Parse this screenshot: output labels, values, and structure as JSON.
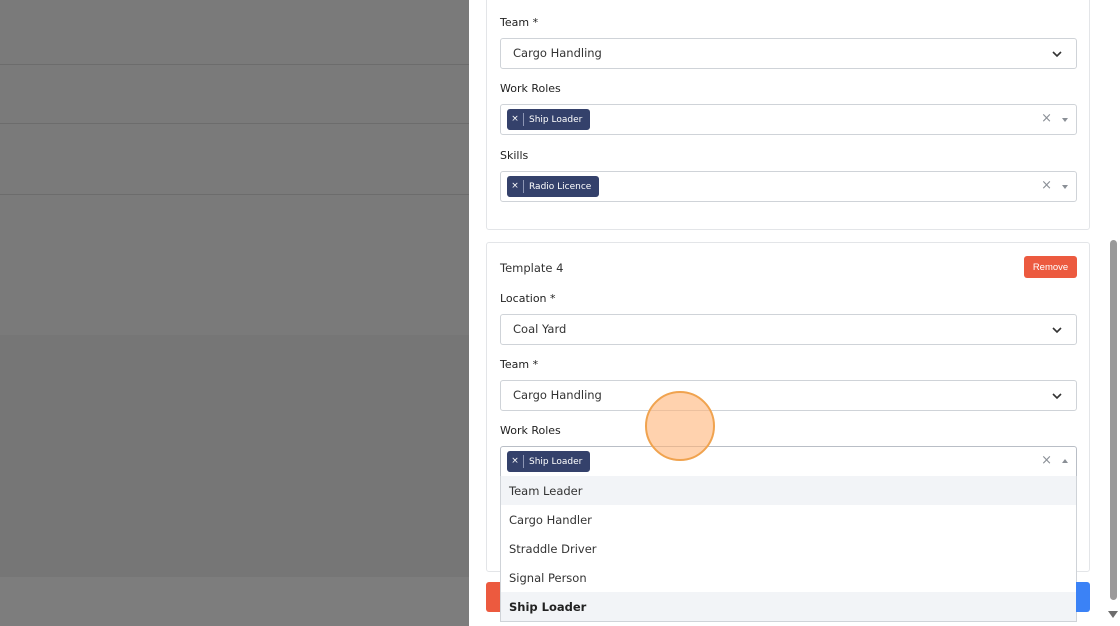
{
  "form": {
    "top_card": {
      "team_label": "Team *",
      "team_value": "Cargo Handling",
      "work_roles_label": "Work Roles",
      "work_roles_tag": "Ship Loader",
      "skills_label": "Skills",
      "skills_tag": "Radio Licence"
    },
    "template4": {
      "title": "Template 4",
      "remove_label": "Remove",
      "location_label": "Location *",
      "location_value": "Coal Yard",
      "team_label": "Team *",
      "team_value": "Cargo Handling",
      "work_roles_label": "Work Roles",
      "work_roles_tag": "Ship Loader",
      "dropdown_options": [
        "Team Leader",
        "Cargo Handler",
        "Straddle Driver",
        "Signal Person",
        "Ship Loader"
      ]
    }
  },
  "tag_remove_glyph": "×",
  "clear_glyph": "×",
  "colors": {
    "tag_bg": "#34416b",
    "remove_btn": "#ec5a3f",
    "primary_btn": "#3b82f6"
  }
}
